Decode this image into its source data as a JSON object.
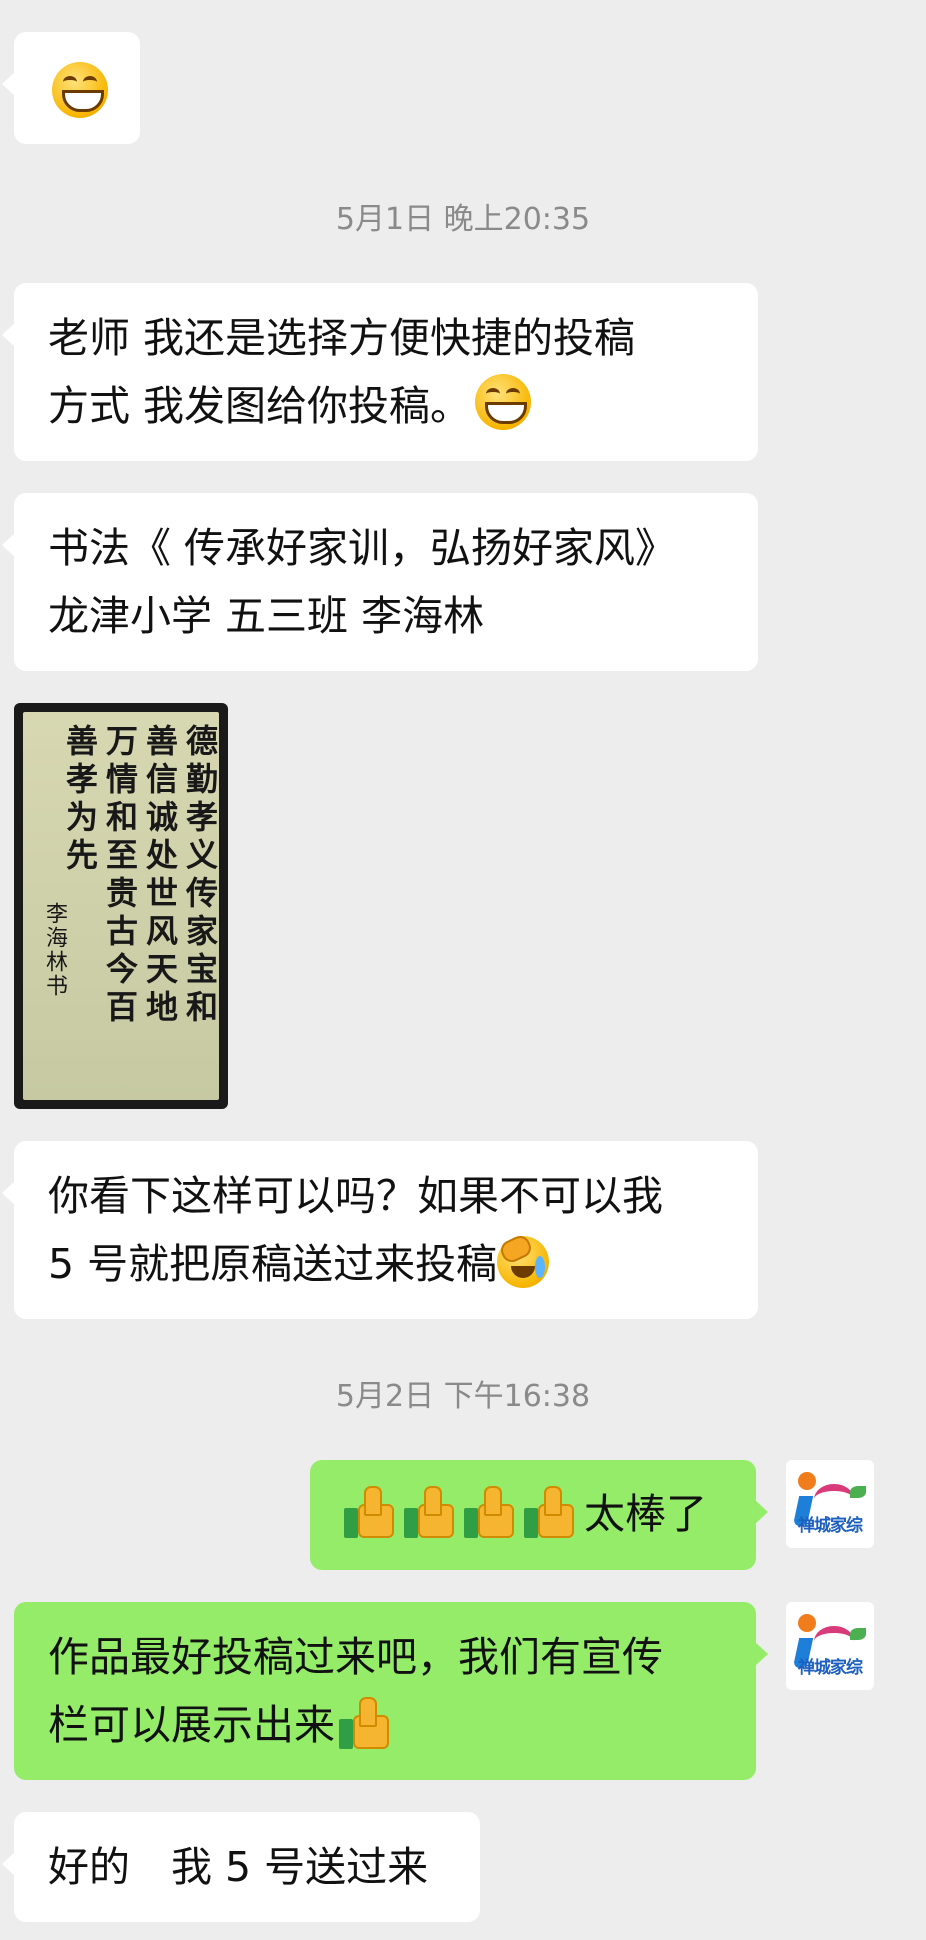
{
  "messages": {
    "m1_emoji": "grinning-squint-emoji",
    "ts1": "5月1日 晚上20:35",
    "m2_line1": "老师 我还是选择方便快捷的投稿",
    "m2_line2": "方式 我发图给你投稿。",
    "m3_line1": "书法《 传承好家训，弘扬好家风》",
    "m3_line2": "龙津小学 五三班 李海林",
    "image": {
      "columns": [
        "德勤孝义传家宝和",
        "善信诚处世风天地",
        "万情和至贵古今百",
        "善孝为先",
        "李海林书"
      ]
    },
    "m4_line1": "你看下这样可以吗？如果不可以我",
    "m4_line2": "5 号就把原稿送过来投稿",
    "ts2": "5月2日 下午16:38",
    "m5_text": "太棒了",
    "m6_line1": "作品最好投稿过来吧，我们有宣传",
    "m6_line2": "栏可以展示出来",
    "m7_text": "好的　我 5 号送过来",
    "avatar_label": "禅城家综"
  },
  "colors": {
    "background": "#ededed",
    "incoming": "#ffffff",
    "outgoing": "#95ec69"
  }
}
